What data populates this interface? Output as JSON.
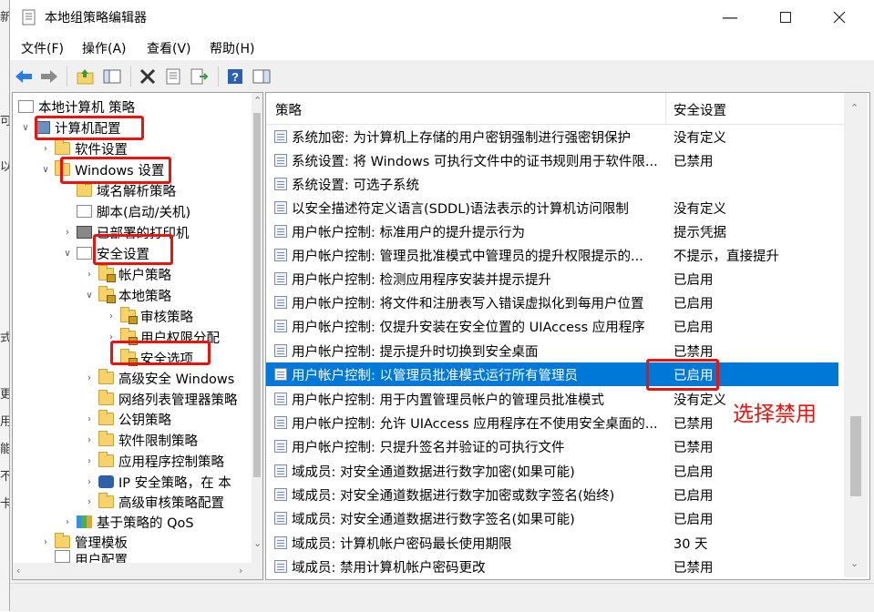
{
  "window": {
    "title": "本地组策略编辑器",
    "minimize_icon": "minimize-icon",
    "maximize_icon": "maximize-icon",
    "close_icon": "close-icon"
  },
  "menu": [
    {
      "label": "文件(F)"
    },
    {
      "label": "操作(A)"
    },
    {
      "label": "查看(V)"
    },
    {
      "label": "帮助(H)"
    }
  ],
  "toolbar": [
    "back-arrow-icon",
    "forward-arrow-icon",
    "up-folder-icon",
    "show-hide-tree-icon",
    "delete-icon",
    "properties-icon",
    "export-list-icon",
    "help-icon",
    "view-icon"
  ],
  "tree": [
    {
      "label": "本地计算机 策略",
      "icon": "doc-icon"
    },
    {
      "label": "计算机配置",
      "icon": "computer-icon"
    },
    {
      "label": "软件设置",
      "icon": "folder-icon"
    },
    {
      "label": "Windows 设置",
      "icon": "folder-icon"
    },
    {
      "label": "域名解析策略",
      "icon": "folder-icon"
    },
    {
      "label": "脚本(启动/关机)",
      "icon": "doc-icon"
    },
    {
      "label": "已部署的打印机",
      "icon": "printer-icon"
    },
    {
      "label": "安全设置",
      "icon": "doc-icon"
    },
    {
      "label": "帐户策略",
      "icon": "lock-folder-icon"
    },
    {
      "label": "本地策略",
      "icon": "lock-folder-icon"
    },
    {
      "label": "审核策略",
      "icon": "lock-folder-icon"
    },
    {
      "label": "用户权限分配",
      "icon": "lock-folder-icon"
    },
    {
      "label": "安全选项",
      "icon": "lock-folder-icon"
    },
    {
      "label": "高级安全 Windows",
      "icon": "folder-icon"
    },
    {
      "label": "网络列表管理器策略",
      "icon": "folder-icon"
    },
    {
      "label": "公钥策略",
      "icon": "folder-icon"
    },
    {
      "label": "软件限制策略",
      "icon": "folder-icon"
    },
    {
      "label": "应用程序控制策略",
      "icon": "folder-icon"
    },
    {
      "label": "IP 安全策略，在 本",
      "icon": "shield-icon"
    },
    {
      "label": "高级审核策略配置",
      "icon": "folder-icon"
    },
    {
      "label": "基于策略的 QoS",
      "icon": "chart-icon"
    },
    {
      "label": "管理模板",
      "icon": "folder-icon"
    },
    {
      "label": "用户配置",
      "icon": "doc-icon"
    }
  ],
  "list": {
    "col_policy": "策略",
    "col_setting": "安全设置",
    "rows": [
      {
        "policy": "系统加密: 为计算机上存储的用户密钥强制进行强密钥保护",
        "setting": "没有定义"
      },
      {
        "policy": "系统设置: 将 Windows 可执行文件中的证书规则用于软件限...",
        "setting": "已禁用"
      },
      {
        "policy": "系统设置: 可选子系统",
        "setting": ""
      },
      {
        "policy": "以安全描述符定义语言(SDDL)语法表示的计算机访问限制",
        "setting": "没有定义"
      },
      {
        "policy": "用户帐户控制: 标准用户的提升提示行为",
        "setting": "提示凭据"
      },
      {
        "policy": "用户帐户控制: 管理员批准模式中管理员的提升权限提示的...",
        "setting": "不提示，直接提升"
      },
      {
        "policy": "用户帐户控制: 检测应用程序安装并提示提升",
        "setting": "已启用"
      },
      {
        "policy": "用户帐户控制: 将文件和注册表写入错误虚拟化到每用户位置",
        "setting": "已启用"
      },
      {
        "policy": "用户帐户控制: 仅提升安装在安全位置的 UIAccess 应用程序",
        "setting": "已启用"
      },
      {
        "policy": "用户帐户控制: 提示提升时切换到安全桌面",
        "setting": "已禁用"
      },
      {
        "policy": "用户帐户控制: 以管理员批准模式运行所有管理员",
        "setting": "已启用"
      },
      {
        "policy": "用户帐户控制: 用于内置管理员帐户的管理员批准模式",
        "setting": "没有定义"
      },
      {
        "policy": "用户帐户控制: 允许 UIAccess 应用程序在不使用安全桌面的...",
        "setting": "已禁用"
      },
      {
        "policy": "用户帐户控制: 只提升签名并验证的可执行文件",
        "setting": "已禁用"
      },
      {
        "policy": "域成员: 对安全通道数据进行数字加密(如果可能)",
        "setting": "已启用"
      },
      {
        "policy": "域成员: 对安全通道数据进行数字加密或数字签名(始终)",
        "setting": "已启用"
      },
      {
        "policy": "域成员: 对安全通道数据进行数字签名(如果可能)",
        "setting": "已启用"
      },
      {
        "policy": "域成员: 计算机帐户密码最长使用期限",
        "setting": "30 天"
      },
      {
        "policy": "域成员: 禁用计算机帐户密码更改",
        "setting": "已禁用"
      }
    ]
  },
  "annotation": "选择禁用",
  "side_chars": [
    "新",
    "可",
    "以",
    "式",
    "更",
    "用",
    "能",
    "不",
    "卡"
  ],
  "colors": {
    "selection": "#0078d7",
    "highlight": "#e8140d"
  }
}
